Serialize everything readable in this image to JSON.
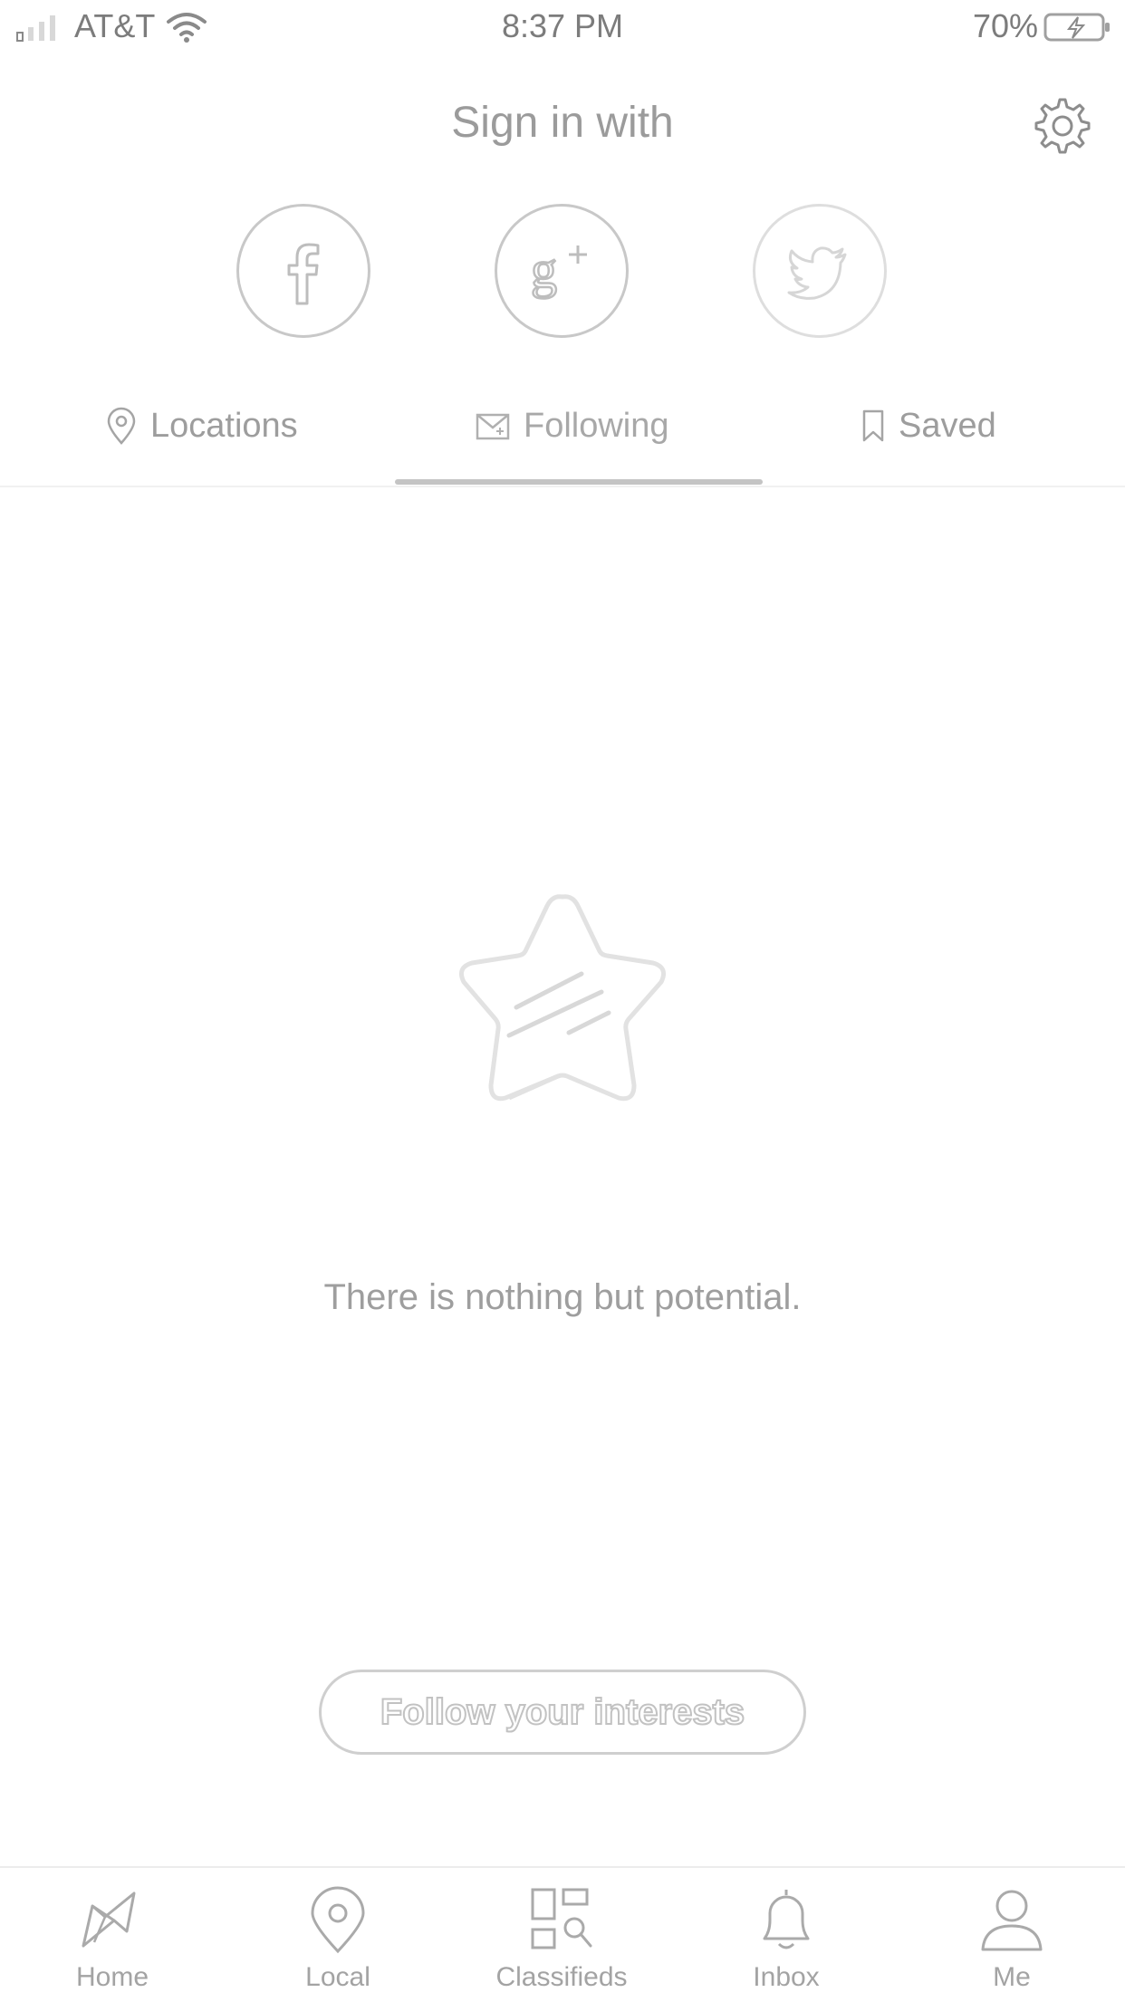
{
  "status_bar": {
    "carrier": "AT&T",
    "time": "8:37 PM",
    "battery_percent": "70%"
  },
  "header": {
    "title": "Sign in with",
    "settings_icon": "gear-icon",
    "social": [
      {
        "name": "Facebook",
        "icon": "facebook-icon"
      },
      {
        "name": "Google+",
        "icon": "google-plus-icon"
      },
      {
        "name": "Twitter",
        "icon": "twitter-icon"
      }
    ]
  },
  "tabs": {
    "items": [
      {
        "label": "Locations",
        "icon": "location-pin-icon"
      },
      {
        "label": "Following",
        "icon": "envelope-icon"
      },
      {
        "label": "Saved",
        "icon": "bookmark-icon"
      }
    ],
    "active": "Following"
  },
  "empty_state": {
    "icon": "star-icon",
    "message": "There is nothing but potential.",
    "button_label": "Follow your interests"
  },
  "tab_bar": {
    "items": [
      {
        "label": "Home",
        "icon": "home-icon"
      },
      {
        "label": "Local",
        "icon": "location-pin-icon"
      },
      {
        "label": "Classifieds",
        "icon": "classifieds-icon"
      },
      {
        "label": "Inbox",
        "icon": "bell-icon"
      },
      {
        "label": "Me",
        "icon": "person-icon"
      }
    ]
  },
  "colors": {
    "icon_stroke": "#c8c8c8",
    "text_gray": "#9b9b9b",
    "indicator": "#c4c4c4"
  }
}
